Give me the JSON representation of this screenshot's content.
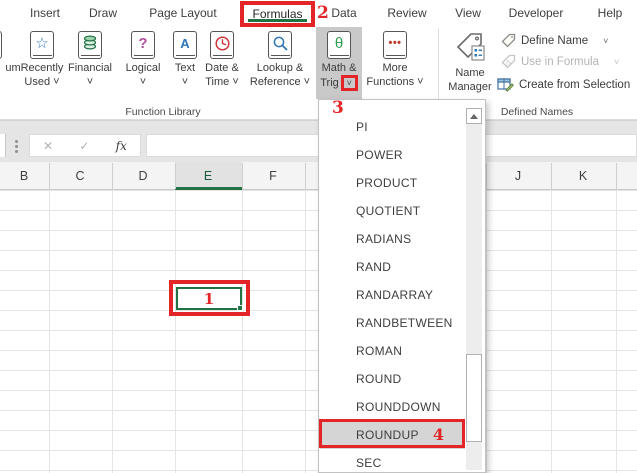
{
  "tabs": {
    "items": [
      "Insert",
      "Draw",
      "Page Layout",
      "Formulas",
      "Data",
      "Review",
      "View",
      "Developer",
      "Help"
    ],
    "active_tab": "Formulas"
  },
  "annotations": {
    "one": "1",
    "two": "2",
    "three": "3",
    "four": "4"
  },
  "ribbon": {
    "group_function_library": "Function Library",
    "group_defined_names": "Defined Names",
    "autosum_partial": "um",
    "buttons": {
      "recently_used": {
        "l1": "Recently",
        "l2": "Used ˅"
      },
      "financial": {
        "l1": "Financial",
        "l2": "˅"
      },
      "logical": {
        "l1": "Logical",
        "l2": "˅"
      },
      "text": {
        "l1": "Text",
        "l2": "˅"
      },
      "date_time": {
        "l1": "Date &",
        "l2": "Time ˅"
      },
      "lookup_reference": {
        "l1": "Lookup &",
        "l2": "Reference ˅"
      },
      "math_trig": {
        "l1": "Math &",
        "l2": "Trig",
        "arrow": "˅"
      },
      "more_functions": {
        "l1": "More",
        "l2": "Functions ˅"
      }
    },
    "icons": {
      "recently_used": "☆",
      "logical": "?",
      "text": "A",
      "math_trig": "θ",
      "more_functions": "•••"
    },
    "defined_names": {
      "name_manager_l1": "Name",
      "name_manager_l2": "Manager",
      "define_name": "Define Name",
      "use_in_formula": "Use in Formula",
      "create_from_selection": "Create from Selection",
      "chevron": "˅"
    }
  },
  "formula_bar": {
    "cancel": "✕",
    "enter": "✓",
    "fx": "fx"
  },
  "sheet": {
    "columns_left": [
      "B",
      "C",
      "D",
      "E",
      "F"
    ],
    "columns_right": [
      "J",
      "K"
    ],
    "selected_column": "E"
  },
  "dropdown": {
    "items": [
      "PI",
      "POWER",
      "PRODUCT",
      "QUOTIENT",
      "RADIANS",
      "RAND",
      "RANDARRAY",
      "RANDBETWEEN",
      "ROMAN",
      "ROUND",
      "ROUNDDOWN",
      "ROUNDUP",
      "SEC"
    ],
    "highlighted_item": "ROUNDUP"
  },
  "colors": {
    "excel_green": "#217346",
    "annotation_red": "#e42527",
    "pressed_gray": "#c9c9c9",
    "menu_highlight_gray": "#d5d5d5"
  }
}
